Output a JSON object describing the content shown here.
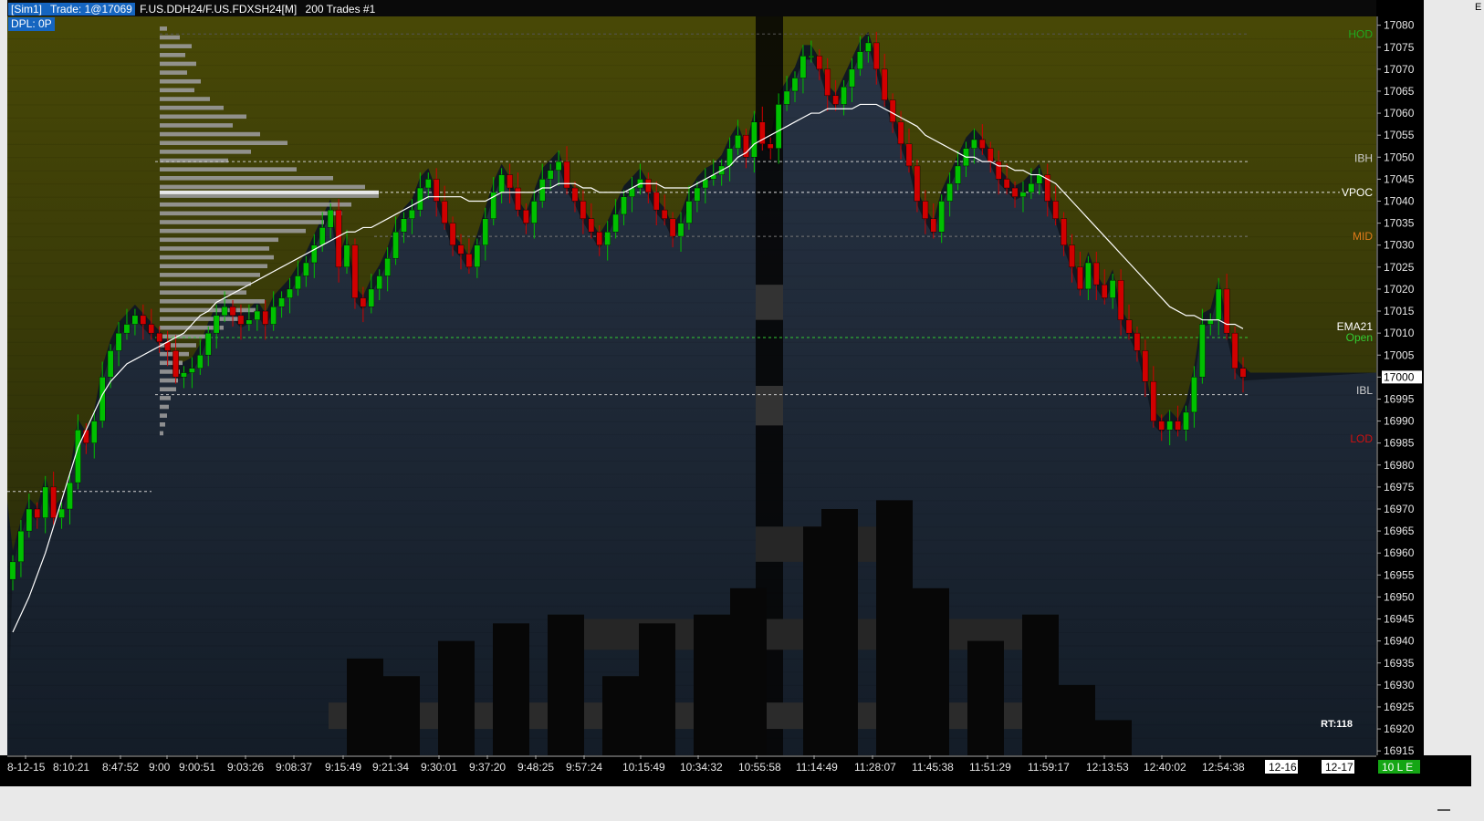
{
  "header": {
    "sim_tag": "[Sim1]",
    "trade": "Trade: 1@17069",
    "instrument": "F.US.DDH24/F.US.FDXSH24[M]",
    "trades": "200 Trades #1"
  },
  "dpl": "DPL: 0P",
  "corner_label": "E",
  "rt_label": "RT:118",
  "colors": {
    "up_candle": "#00c000",
    "down_candle": "#d00000",
    "ema": "#ffffff",
    "open_line": "#33cc33",
    "current_price_bg": "#ffffff",
    "heatmap_ask": "#5a5a00",
    "heatmap_bid": "#1c2a3a",
    "axis_bg": "#000000"
  },
  "level_labels": {
    "hod": "HOD",
    "ibh": "IBH",
    "vpoc": "VPOC",
    "mid": "MID",
    "ema": "EMA21",
    "open": "Open",
    "ibl": "IBL",
    "lod": "LOD"
  },
  "time_labels": [
    "8-12-15",
    "8:10:21",
    "8:47:52",
    "9:00",
    "9:00:51",
    "9:03:26",
    "9:08:37",
    "9:15:49",
    "9:21:34",
    "9:30:01",
    "9:37:20",
    "9:48:25",
    "9:57:24",
    "10:15:49",
    "10:34:32",
    "10:55:58",
    "11:14:49",
    "11:28:07",
    "11:45:38",
    "11:51:29",
    "11:59:17",
    "12:13:53",
    "12:40:02",
    "12:54:38"
  ],
  "date_labels": [
    "12-16",
    "12-17"
  ],
  "status_label": "10 L E",
  "chart_data": {
    "type": "candlestick",
    "ylim": [
      16914,
      17082
    ],
    "y_ticks": [
      16915,
      16920,
      16925,
      16930,
      16935,
      16940,
      16945,
      16950,
      16955,
      16960,
      16965,
      16970,
      16975,
      16980,
      16985,
      16990,
      16995,
      17000,
      17005,
      17010,
      17015,
      17020,
      17025,
      17030,
      17035,
      17040,
      17045,
      17050,
      17055,
      17060,
      17065,
      17070,
      17075,
      17080
    ],
    "current_price": 17000,
    "levels": {
      "hod": 17078,
      "ibh": 17049,
      "vpoc": 17042,
      "mid": 17032,
      "open": 17009,
      "ibl": 16996,
      "lod": 16986
    },
    "closes": [
      16958,
      16965,
      16970,
      16968,
      16975,
      16968,
      16970,
      16976,
      16988,
      16985,
      16990,
      17000,
      17006,
      17010,
      17012,
      17014,
      17012,
      17010,
      17008,
      17006,
      17000,
      17001,
      17002,
      17005,
      17010,
      17014,
      17016,
      17014,
      17012,
      17013,
      17015,
      17012,
      17016,
      17018,
      17020,
      17023,
      17026,
      17030,
      17034,
      17038,
      17025,
      17030,
      17018,
      17016,
      17020,
      17023,
      17027,
      17033,
      17036,
      17038,
      17043,
      17045,
      17040,
      17035,
      17030,
      17028,
      17025,
      17030,
      17036,
      17042,
      17046,
      17043,
      17038,
      17035,
      17040,
      17045,
      17047,
      17049,
      17043,
      17040,
      17036,
      17033,
      17030,
      17033,
      17037,
      17041,
      17043,
      17045,
      17042,
      17038,
      17036,
      17032,
      17035,
      17040,
      17043,
      17045,
      17046,
      17048,
      17052,
      17055,
      17050,
      17058,
      17053,
      17052,
      17062,
      17065,
      17068,
      17073,
      17073,
      17070,
      17064,
      17062,
      17066,
      17070,
      17074,
      17076,
      17070,
      17063,
      17058,
      17053,
      17048,
      17040,
      17036,
      17033,
      17040,
      17044,
      17048,
      17052,
      17054,
      17052,
      17049,
      17045,
      17043,
      17041,
      17042,
      17044,
      17046,
      17040,
      17036,
      17030,
      17025,
      17020,
      17026,
      17021,
      17018,
      17022,
      17013,
      17010,
      17006,
      16999,
      16990,
      16988,
      16990,
      16988,
      16992,
      17000,
      17012,
      17013,
      17020,
      17010,
      17002,
      17000
    ],
    "ema21": [
      16942,
      16946,
      16950,
      16955,
      16960,
      16966,
      16972,
      16978,
      16984,
      16988,
      16992,
      16996,
      16999,
      17001,
      17003,
      17004,
      17005,
      17006,
      17007,
      17008,
      17009,
      17010,
      17012,
      17014,
      17015,
      17017,
      17018,
      17019,
      17020,
      17021,
      17022,
      17023,
      17024,
      17025,
      17026,
      17027,
      17028,
      17029,
      17030,
      17031,
      17032,
      17033,
      17033,
      17034,
      17034,
      17035,
      17036,
      17037,
      17038,
      17039,
      17040,
      17041,
      17041,
      17041,
      17041,
      17041,
      17040,
      17040,
      17040,
      17041,
      17042,
      17042,
      17042,
      17042,
      17042,
      17043,
      17043,
      17044,
      17044,
      17044,
      17043,
      17043,
      17042,
      17042,
      17042,
      17042,
      17043,
      17044,
      17044,
      17044,
      17043,
      17043,
      17043,
      17043,
      17044,
      17045,
      17046,
      17047,
      17048,
      17050,
      17051,
      17053,
      17054,
      17055,
      17056,
      17057,
      17058,
      17059,
      17060,
      17060,
      17061,
      17061,
      17061,
      17061,
      17062,
      17062,
      17062,
      17061,
      17060,
      17059,
      17058,
      17057,
      17055,
      17054,
      17053,
      17052,
      17051,
      17050,
      17050,
      17049,
      17049,
      17048,
      17048,
      17047,
      17047,
      17046,
      17046,
      17045,
      17044,
      17042,
      17040,
      17038,
      17036,
      17034,
      17032,
      17030,
      17028,
      17026,
      17024,
      17022,
      17020,
      17018,
      17016,
      17015,
      17014,
      17014,
      17013,
      17013,
      17013,
      17012,
      17012,
      17011
    ]
  }
}
